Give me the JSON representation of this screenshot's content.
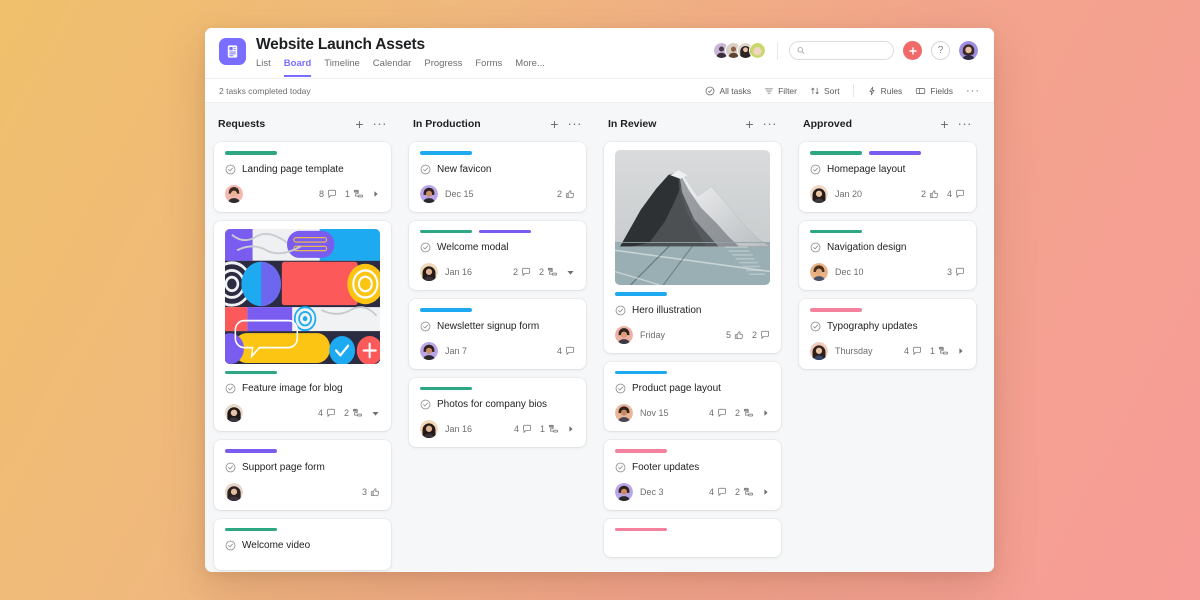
{
  "header": {
    "project_icon": "board-list-icon",
    "title": "Website Launch Assets",
    "tabs": [
      {
        "label": "List",
        "active": false
      },
      {
        "label": "Board",
        "active": true
      },
      {
        "label": "Timeline",
        "active": false
      },
      {
        "label": "Calendar",
        "active": false
      },
      {
        "label": "Progress",
        "active": false
      },
      {
        "label": "Forms",
        "active": false
      },
      {
        "label": "More...",
        "active": false
      }
    ],
    "search": {
      "value": "",
      "placeholder": "",
      "icon": "search-icon"
    },
    "add_button_icon": "plus-icon",
    "help_button_label": "?",
    "members": [
      {
        "name": "member-1",
        "colors": [
          "#c9b6d8",
          "#4a3b46"
        ]
      },
      {
        "name": "member-2",
        "colors": [
          "#d9cfc4",
          "#6b4f3a"
        ]
      },
      {
        "name": "member-3",
        "colors": [
          "#e0d6cc",
          "#2b2320"
        ]
      },
      {
        "name": "member-4",
        "colors": [
          "#c9d86b",
          "#f2d5c0"
        ]
      }
    ],
    "current_user_avatar": "#8f7ad8"
  },
  "subbar": {
    "completed_note": "2 tasks completed today",
    "tools": [
      {
        "label": "All tasks",
        "icon": "check-circle-icon"
      },
      {
        "label": "Filter",
        "icon": "filter-icon"
      },
      {
        "label": "Sort",
        "icon": "sort-icon"
      },
      {
        "label": "Rules",
        "icon": "bolt-icon"
      },
      {
        "label": "Fields",
        "icon": "fields-icon"
      }
    ],
    "overflow_icon": "ellipsis-icon"
  },
  "colors": {
    "accent": "#796eff",
    "add": "#f06a6a",
    "tag_green": "#2ea884",
    "tag_blue": "#1eaaf1",
    "tag_purple": "#7b5cf0",
    "tag_pink": "#f4829f",
    "board_bg": "#f6f7f8"
  },
  "board": {
    "columns": [
      {
        "title": "Requests",
        "add_icon": "plus-icon",
        "menu_icon": "ellipsis-icon",
        "cards": [
          {
            "title": "Landing page template",
            "tags": [
              "green"
            ],
            "cover": null,
            "avatar": "#f0a89c",
            "avatar_hair": "#3b2a22",
            "due": "",
            "meta": [
              {
                "icon": "comment-icon",
                "count": "8"
              },
              {
                "icon": "subtask-icon",
                "count": "1"
              }
            ],
            "trailing_icon": "caret-right-icon"
          },
          {
            "title": "Feature image for blog",
            "tags": [
              "green"
            ],
            "cover": "collage-cover",
            "avatar": "#e8d9cd",
            "avatar_hair": "#221a16",
            "due": "",
            "meta": [
              {
                "icon": "comment-icon",
                "count": "4"
              },
              {
                "icon": "subtask-icon",
                "count": "2"
              }
            ],
            "trailing_icon": "caret-down-icon"
          },
          {
            "title": "Support page form",
            "tags": [
              "purple"
            ],
            "cover": null,
            "avatar": "#e6d5c8",
            "avatar_hair": "#2a2120",
            "due": "",
            "meta": [
              {
                "icon": "thumbsup-icon",
                "count": "3"
              }
            ],
            "trailing_icon": null
          },
          {
            "title": "Welcome video",
            "tags": [
              "green"
            ],
            "cover": null,
            "avatar": null,
            "due": "",
            "meta": [],
            "trailing_icon": null
          }
        ]
      },
      {
        "title": "In Production",
        "add_icon": "plus-icon",
        "menu_icon": "ellipsis-icon",
        "cards": [
          {
            "title": "New favicon",
            "tags": [
              "blue"
            ],
            "cover": null,
            "avatar": "#b9a6e8",
            "avatar_hair": "#31211c",
            "due": "Dec 15",
            "meta": [
              {
                "icon": "thumbsup-icon",
                "count": "2"
              }
            ],
            "trailing_icon": null
          },
          {
            "title": "Welcome modal",
            "tags": [
              "green",
              "purple"
            ],
            "cover": null,
            "avatar": "#f2d7b8",
            "avatar_hair": "#241b18",
            "due": "Jan 16",
            "meta": [
              {
                "icon": "comment-icon",
                "count": "2"
              },
              {
                "icon": "subtask-icon",
                "count": "2"
              }
            ],
            "trailing_icon": "caret-down-icon"
          },
          {
            "title": "Newsletter signup form",
            "tags": [
              "blue"
            ],
            "cover": null,
            "avatar": "#b9a6e8",
            "avatar_hair": "#31211c",
            "due": "Jan 7",
            "meta": [
              {
                "icon": "comment-icon",
                "count": "4"
              }
            ],
            "trailing_icon": null
          },
          {
            "title": "Photos for company bios",
            "tags": [
              "green"
            ],
            "cover": null,
            "avatar": "#f2d7b8",
            "avatar_hair": "#241b18",
            "due": "Jan 16",
            "meta": [
              {
                "icon": "comment-icon",
                "count": "4"
              },
              {
                "icon": "subtask-icon",
                "count": "1"
              }
            ],
            "trailing_icon": "caret-right-icon"
          }
        ]
      },
      {
        "title": "In Review",
        "add_icon": "plus-icon",
        "menu_icon": "ellipsis-icon",
        "cards": [
          {
            "title": "Hero illustration",
            "tags": [
              "blue"
            ],
            "cover": "mountain-cover",
            "avatar": "#f0b0a4",
            "avatar_hair": "#2f2420",
            "due": "Friday",
            "meta": [
              {
                "icon": "thumbsup-icon",
                "count": "5"
              },
              {
                "icon": "comment-icon",
                "count": "2"
              }
            ],
            "trailing_icon": null
          },
          {
            "title": "Product page layout",
            "tags": [
              "blue"
            ],
            "cover": null,
            "avatar": "#e8b79a",
            "avatar_hair": "#33221b",
            "due": "Nov 15",
            "meta": [
              {
                "icon": "comment-icon",
                "count": "4"
              },
              {
                "icon": "subtask-icon",
                "count": "2"
              }
            ],
            "trailing_icon": "caret-right-icon"
          },
          {
            "title": "Footer updates",
            "tags": [
              "pink"
            ],
            "cover": null,
            "avatar": "#b9a6e8",
            "avatar_hair": "#31211c",
            "due": "Dec 3",
            "meta": [
              {
                "icon": "comment-icon",
                "count": "4"
              },
              {
                "icon": "subtask-icon",
                "count": "2"
              }
            ],
            "trailing_icon": "caret-right-icon"
          },
          {
            "title": "",
            "tags": [
              "pink"
            ],
            "cover": null,
            "avatar": null,
            "due": "",
            "meta": [],
            "trailing_icon": null
          }
        ]
      },
      {
        "title": "Approved",
        "add_icon": "plus-icon",
        "menu_icon": "ellipsis-icon",
        "cards": [
          {
            "title": "Homepage layout",
            "tags": [
              "green",
              "purple"
            ],
            "cover": null,
            "avatar": "#efd9c6",
            "avatar_hair": "#241a17",
            "due": "Jan 20",
            "meta": [
              {
                "icon": "thumbsup-icon",
                "count": "2"
              },
              {
                "icon": "comment-icon",
                "count": "4"
              }
            ],
            "trailing_icon": null
          },
          {
            "title": "Navigation design",
            "tags": [
              "green"
            ],
            "cover": null,
            "avatar": "#e8b487",
            "avatar_hair": "#4a2f1c",
            "due": "Dec 10",
            "meta": [
              {
                "icon": "comment-icon",
                "count": "3"
              }
            ],
            "trailing_icon": null
          },
          {
            "title": "Typography updates",
            "tags": [
              "pink"
            ],
            "cover": null,
            "avatar": "#f0cbbb",
            "avatar_hair": "#2d1f1a",
            "due": "Thursday",
            "meta": [
              {
                "icon": "comment-icon",
                "count": "4"
              },
              {
                "icon": "subtask-icon",
                "count": "1"
              }
            ],
            "trailing_icon": "caret-right-icon"
          }
        ]
      }
    ]
  }
}
